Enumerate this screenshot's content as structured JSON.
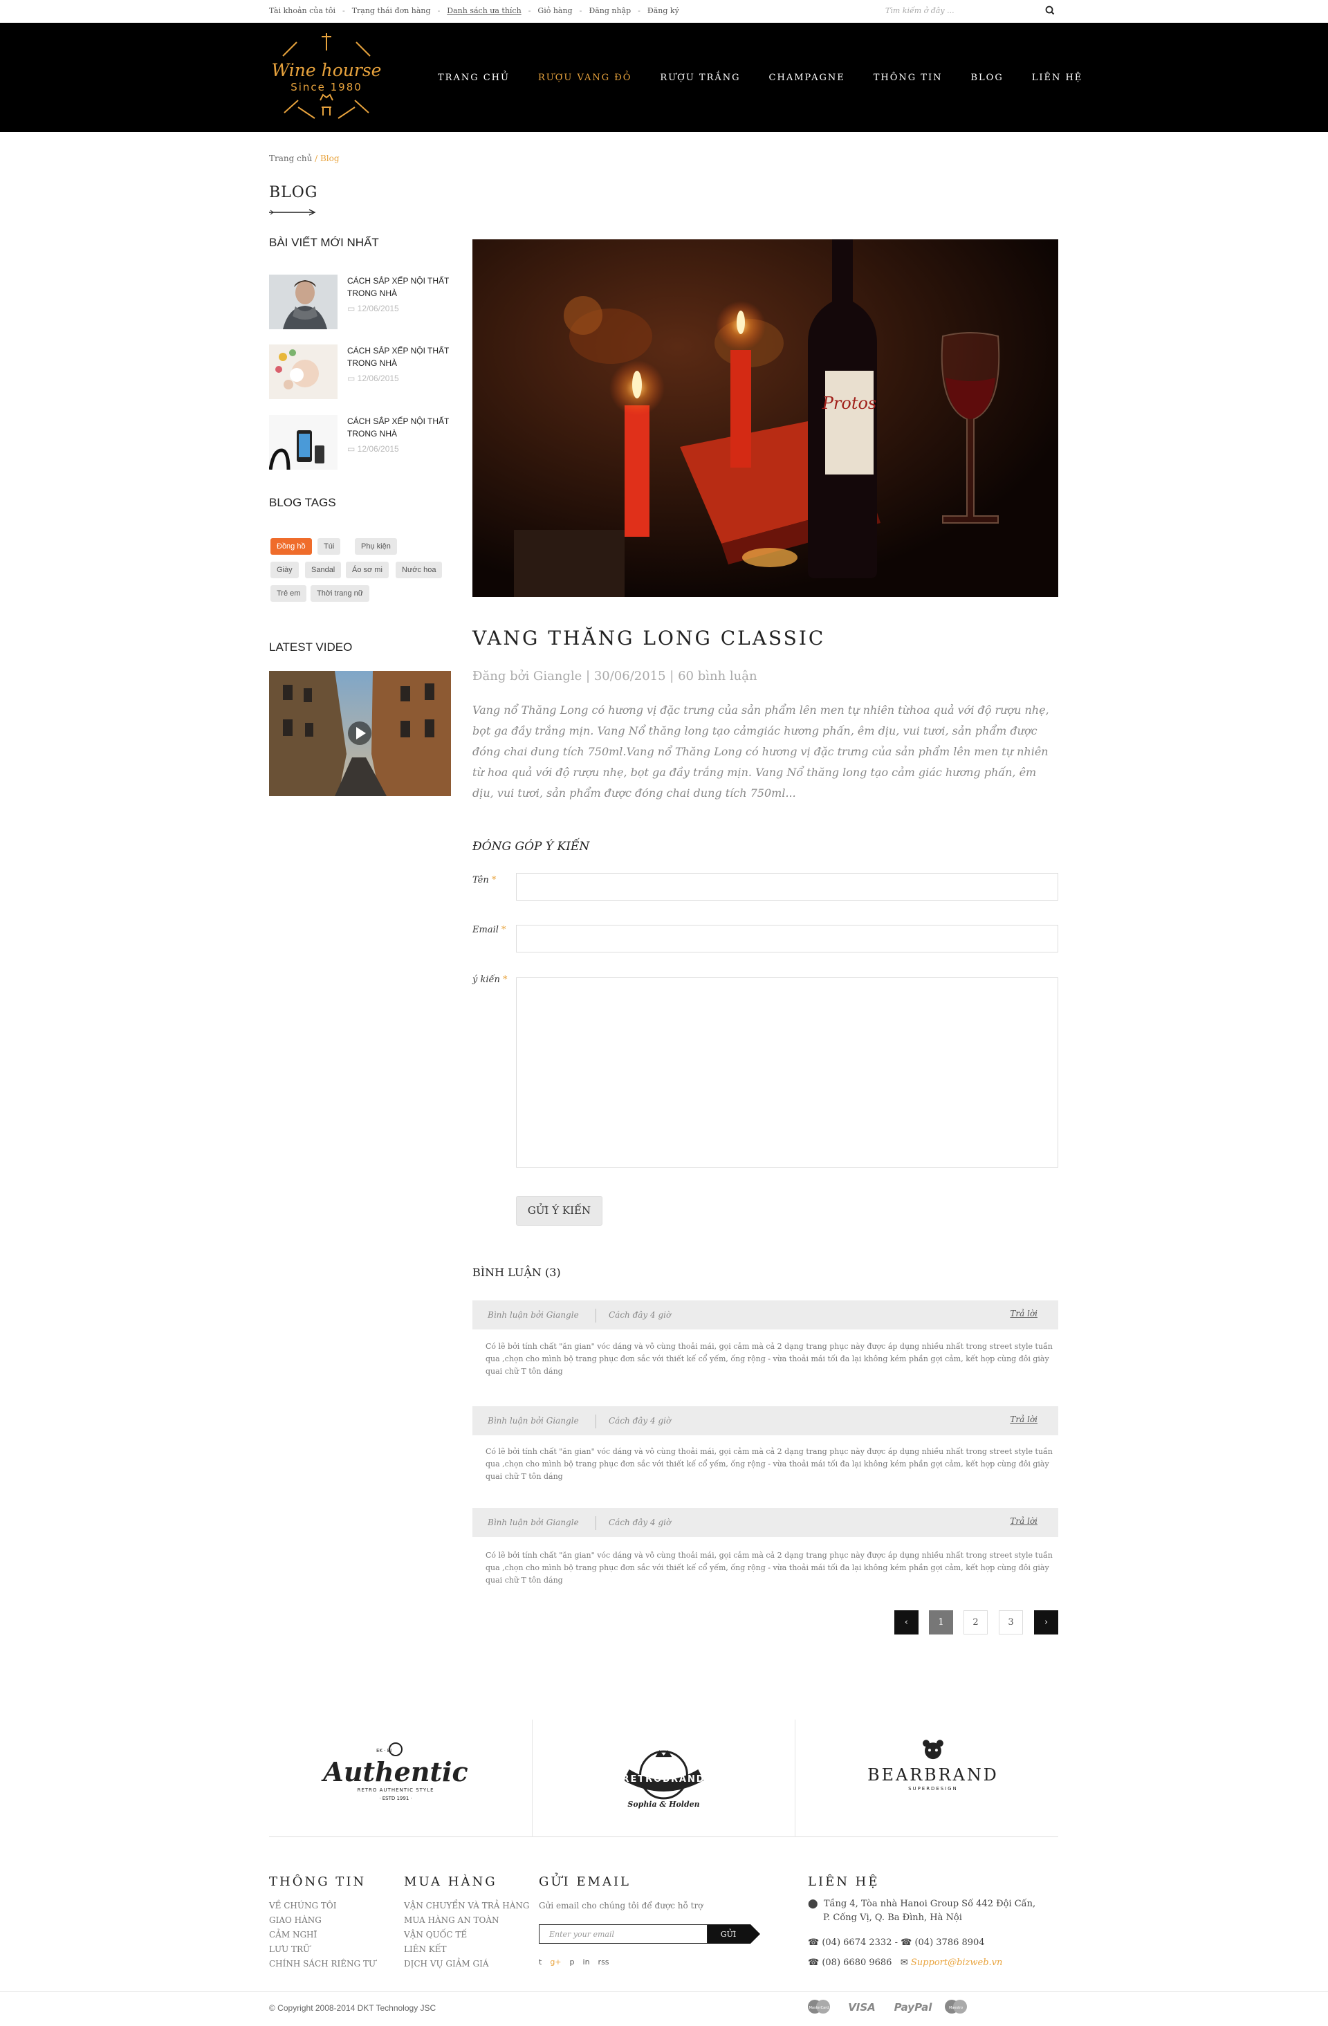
{
  "topbar": {
    "links": [
      "Tài khoản của tôi",
      "Trạng thái đơn hàng",
      "Danh sách ưa thích",
      "Giỏ hàng",
      "Đăng nhập",
      "Đăng ký"
    ],
    "search_placeholder": "Tìm kiếm ở đây ..."
  },
  "header": {
    "logo_text": "Wine hourse",
    "logo_sub": "Since 1980",
    "nav": [
      "TRANG CHỦ",
      "RƯỢU VANG ĐỎ",
      "RƯỢU TRẮNG",
      "CHAMPAGNE",
      "THÔNG TIN",
      "BLOG",
      "LIÊN HỆ"
    ],
    "active_nav": "RƯỢU VANG ĐỎ",
    "accent": "#e8a33d"
  },
  "breadcrumb": {
    "home": "Trang chủ",
    "sep": " / ",
    "current": "Blog"
  },
  "page_title": "BLOG",
  "sidebar": {
    "recent_title": "BÀI VIẾT MỚI NHẤT",
    "posts": [
      {
        "title": "CÁCH SẮP XẾP NỘI THẤT TRONG NHÀ",
        "date": "12/06/2015"
      },
      {
        "title": "CÁCH SẮP XẾP NỘI THẤT TRONG NHÀ",
        "date": "12/06/2015"
      },
      {
        "title": "CÁCH SẮP XẾP NỘI THẤT TRONG NHÀ",
        "date": "12/06/2015"
      }
    ],
    "tags_title": "BLOG TAGS",
    "tags": [
      "Đồng hồ",
      "Túi",
      "Phụ kiện",
      "Giày",
      "Sandal",
      "Áo sơ mi",
      "Nước hoa",
      "Trẻ em",
      "Thời trang nữ"
    ],
    "active_tag": "Đồng hồ",
    "video_title": "LATEST VIDEO"
  },
  "post": {
    "bottle_label": "Protos",
    "title": "VANG THĂNG LONG CLASSIC",
    "meta": "Đăng bởi Giangle | 30/06/2015 | 60 bình luận",
    "excerpt": "Vang nổ Thăng Long có hương vị đặc trưng của sản phẩm lên men tự nhiên từhoa quả với độ rượu nhẹ, bọt ga đầy trắng mịn. Vang Nổ thăng long tạo cảmgiác hương phấn, êm dịu, vui tươi, sản phẩm được đóng chai dung tích 750ml.Vang nổ Thăng Long có hương vị đặc trưng của sản phẩm lên men tự nhiên từ hoa quả với độ rượu nhẹ, bọt ga đầy trắng mịn. Vang Nổ thăng long tạo cảm giác hương phấn, êm dịu, vui tươi, sản phẩm được đóng chai dung tích 750ml..."
  },
  "form": {
    "title": "ĐÓNG GÓP Ý KIẾN",
    "name_label": "Tên",
    "email_label": "Email",
    "comment_label": "ý kiến",
    "required_mark": "*",
    "submit": "GỬI Ý KIẾN"
  },
  "comments": {
    "title": "BÌNH LUẬN (3)",
    "items": [
      {
        "by": "Bình luận bởi Giangle",
        "ago": "Cách đây 4 giờ",
        "reply": "Trả lời",
        "text": "Có lẽ bởi tính chất \"ăn gian\" vóc dáng và vô cùng thoải mái, gọi cảm mà cả 2 dạng trang phục này được áp dụng nhiều nhất trong street style tuần qua ,chọn cho mình bộ trang phục đơn sắc với thiết kế cổ yếm, ống rộng - vừa thoải mái tối đa lại không kém phần gợi cảm, kết hợp cùng đôi giày quai chữ T tôn dáng"
      },
      {
        "by": "Bình luận bởi Giangle",
        "ago": "Cách đây 4 giờ",
        "reply": "Trả lời",
        "text": "Có lẽ bởi tính chất \"ăn gian\" vóc dáng và vô cùng thoải mái, gọi cảm mà cả 2 dạng trang phục này được áp dụng nhiều nhất trong street style tuần qua ,chọn cho mình bộ trang phục đơn sắc với thiết kế cổ yếm, ống rộng - vừa thoải mái tối đa lại không kém phần gợi cảm, kết hợp cùng đôi giày quai chữ T tôn dáng"
      },
      {
        "by": "Bình luận bởi Giangle",
        "ago": "Cách đây 4 giờ",
        "reply": "Trả lời",
        "text": "Có lẽ bởi tính chất \"ăn gian\" vóc dáng và vô cùng thoải mái, gọi cảm mà cả 2 dạng trang phục này được áp dụng nhiều nhất trong street style tuần qua ,chọn cho mình bộ trang phục đơn sắc với thiết kế cổ yếm, ống rộng - vừa thoải mái tối đa lại không kém phần gợi cảm, kết hợp cùng đôi giày quai chữ T tôn dáng"
      }
    ]
  },
  "pagination": {
    "prev": "‹",
    "pages": [
      "1",
      "2",
      "3"
    ],
    "current": "1",
    "next": "›"
  },
  "brands": {
    "authentic": {
      "name": "Authentic",
      "top": "EK · EI",
      "sub": "RETRO AUTHENTIC STYLE",
      "est": "· ESTD 1991 ·"
    },
    "retro": {
      "name": "RETROBRAND",
      "sub": "Sophia & Holden"
    },
    "bear": {
      "name": "BEARBRAND",
      "sub": "SUPERDESIGN"
    }
  },
  "footer": {
    "info": {
      "title": "THÔNG TIN",
      "items": [
        "VỀ CHÚNG TÔI",
        "GIAO HÀNG",
        "CẢM NGHĨ",
        "LƯU TRỮ",
        "CHÍNH SÁCH RIÊNG TƯ"
      ]
    },
    "shop": {
      "title": "MUA HÀNG",
      "items": [
        "VẬN CHUYỂN VÀ TRẢ HÀNG",
        "MUA HÀNG AN TOÀN",
        "VẬN QUỐC TẾ",
        "LIÊN KẾT",
        "DỊCH VỤ GIẢM GIÁ"
      ]
    },
    "email": {
      "title": "GỬI EMAIL",
      "desc": "Gửi email cho chúng tôi để được hỗ trợ",
      "placeholder": "Enter your email",
      "button": "GỬI",
      "social": [
        "t",
        "g+",
        "p",
        "in",
        "rss"
      ]
    },
    "contact": {
      "title": "LIÊN HỆ",
      "address1": "Tầng 4, Tòa nhà Hanoi Group Số 442 Đội Cấn,",
      "address2": "P. Cống Vị, Q. Ba Đình, Hà Nội",
      "phone1": "(04) 6674 2332",
      "phone2": "(04) 3786 8904",
      "phone3": "(08) 6680 9686",
      "email": "Support@bizweb.vn"
    },
    "copyright": "© Copyright 2008-2014 DKT Technology JSC",
    "payments": [
      "MasterCard",
      "VISA",
      "PayPal",
      "Maestro"
    ]
  }
}
